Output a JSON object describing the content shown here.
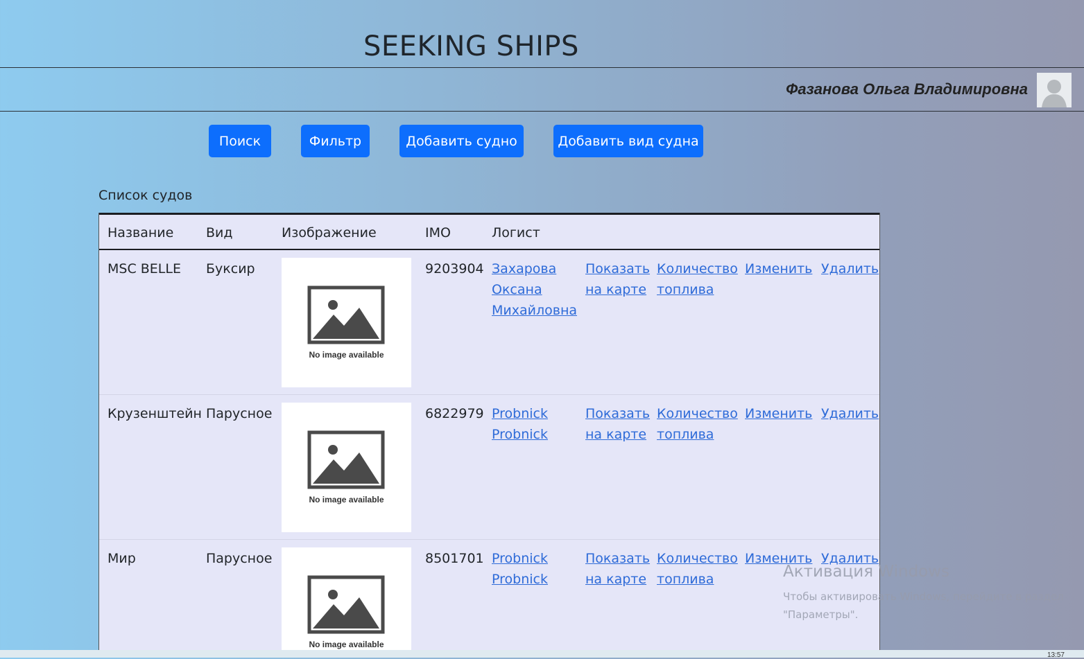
{
  "header": {
    "title": "SEEKING SHIPS",
    "user_name": "Фазанова Ольга Владимировна"
  },
  "toolbar": {
    "search": "Поиск",
    "filter": "Фильтр",
    "add_ship": "Добавить судно",
    "add_ship_type": "Добавить вид судна"
  },
  "list": {
    "caption": "Список судов",
    "columns": [
      "Название",
      "Вид",
      "Изображение",
      "IMO",
      "Логист"
    ],
    "no_image": "No image available",
    "rows": [
      {
        "name": "MSC BELLE",
        "type": "Буксир",
        "imo": "9203904",
        "logist": [
          "Захарова",
          "Оксана",
          "Михайловна"
        ],
        "map": [
          "Показать",
          "на карте"
        ],
        "fuel": [
          "Количество",
          "топлива"
        ],
        "edit": "Изменить",
        "delete": "Удалить"
      },
      {
        "name": "Крузенштейн",
        "type": "Парусное",
        "imo": "6822979",
        "logist": [
          "Probnick",
          "Probnick"
        ],
        "map": [
          "Показать",
          "на карте"
        ],
        "fuel": [
          "Количество",
          "топлива"
        ],
        "edit": "Изменить",
        "delete": "Удалить"
      },
      {
        "name": "Мир",
        "type": "Парусное",
        "imo": "8501701",
        "logist": [
          "Probnick",
          "Probnick"
        ],
        "map": [
          "Показать",
          "на карте"
        ],
        "fuel": [
          "Количество",
          "топлива"
        ],
        "edit": "Изменить",
        "delete": "Удалить"
      }
    ]
  },
  "watermark": {
    "title": "Активация Windows",
    "text": "Чтобы активировать Windows, перейдите в раздел \"Параметры\"."
  },
  "taskbar": {
    "clock": "13:57"
  }
}
